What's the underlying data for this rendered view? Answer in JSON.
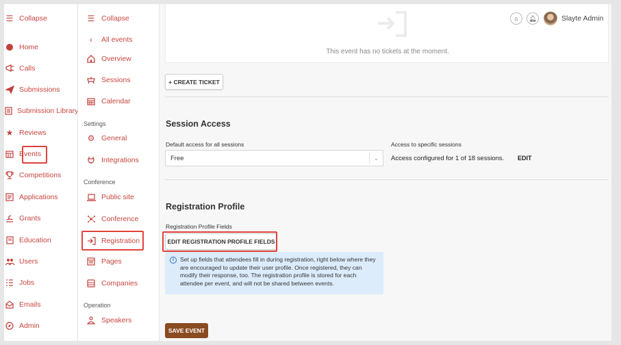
{
  "user": {
    "name": "Slayte Admin"
  },
  "sidebar_main": {
    "items": [
      {
        "label": "Collapse",
        "icon": "menu-icon"
      },
      {
        "label": "Home",
        "icon": "home-dot-icon"
      },
      {
        "label": "Calls",
        "icon": "megaphone-icon"
      },
      {
        "label": "Submissions",
        "icon": "send-icon"
      },
      {
        "label": "Submission Library",
        "icon": "library-icon"
      },
      {
        "label": "Reviews",
        "icon": "star-icon"
      },
      {
        "label": "Events",
        "icon": "calendar-grid-icon"
      },
      {
        "label": "Competitions",
        "icon": "trophy-icon"
      },
      {
        "label": "Applications",
        "icon": "form-icon"
      },
      {
        "label": "Grants",
        "icon": "grant-icon"
      },
      {
        "label": "Education",
        "icon": "book-icon"
      },
      {
        "label": "Users",
        "icon": "users-icon"
      },
      {
        "label": "Jobs",
        "icon": "jobs-icon"
      },
      {
        "label": "Emails",
        "icon": "mail-icon"
      },
      {
        "label": "Admin",
        "icon": "compass-icon"
      }
    ]
  },
  "sidebar_event": {
    "collapse": "Collapse",
    "all_events": "All events",
    "overview": "Overview",
    "sessions": "Sessions",
    "calendar": "Calendar",
    "settings_heading": "Settings",
    "general": "General",
    "integrations": "Integrations",
    "conference_heading": "Conference",
    "public_site": "Public site",
    "conference": "Conference",
    "registration": "Registration",
    "pages": "Pages",
    "companies": "Companies",
    "operation_heading": "Operation",
    "speakers": "Speakers"
  },
  "tickets": {
    "empty_text": "This event has no tickets at the moment.",
    "create_label": "+ CREATE TICKET"
  },
  "session_access": {
    "title": "Session Access",
    "default_label": "Default access for all sessions",
    "default_value": "Free",
    "specific_label": "Access to specific sessions",
    "specific_text": "Access configured for 1 of 18 sessions.",
    "edit_label": "EDIT"
  },
  "registration_profile": {
    "title": "Registration Profile",
    "fields_label": "Registration Profile Fields",
    "edit_button": "EDIT REGISTRATION PROFILE FIELDS",
    "info_text": "Set up fields that attendees fill in during registration, right below where they are encouraged to update their user profile. Once registered, they can modify their response, too. The registration profile is stored for each attendee per event, and will not be shared between events."
  },
  "save_label": "SAVE EVENT",
  "colors": {
    "accent": "#c8453f",
    "highlight": "#e0423c",
    "save": "#8a4b21",
    "info_bg": "#dcecfb"
  }
}
